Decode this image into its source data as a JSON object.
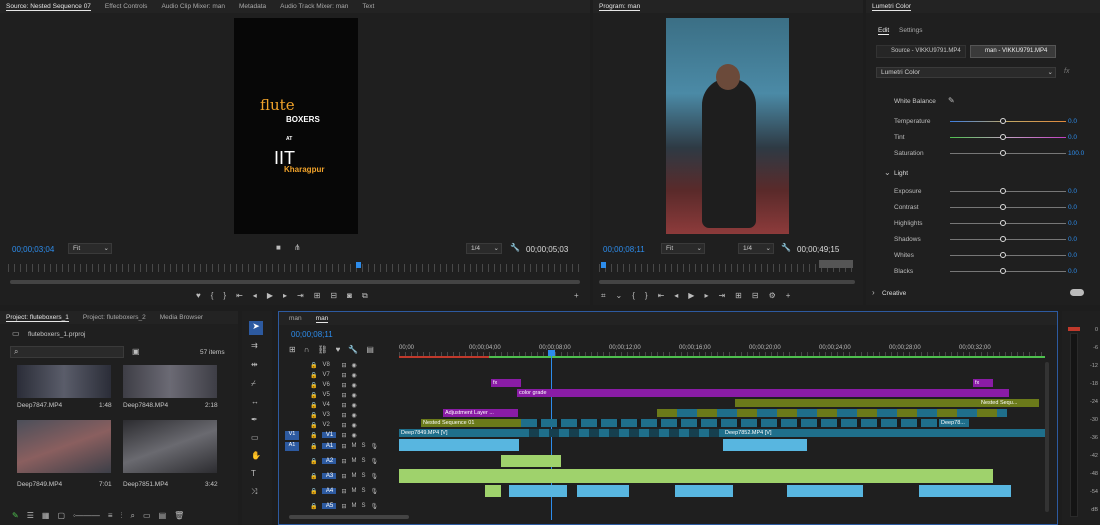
{
  "source_panel": {
    "tabs": [
      "Source: Nested Sequence 07",
      "Effect Controls",
      "Audio Clip Mixer: man",
      "Metadata",
      "Audio Track Mixer: man",
      "Text"
    ],
    "timecode_left": "00;00;03;04",
    "fit": "Fit",
    "resolution": "1/4",
    "timecode_right": "00;00;05;03",
    "preview": {
      "line1": "flute",
      "line2": "BOXERS",
      "line3": "AT",
      "line4": "IIT",
      "line5": "Kharagpur"
    }
  },
  "program_panel": {
    "tab": "Program: man",
    "timecode_left": "00;00;08;11",
    "fit": "Fit",
    "resolution": "1/4",
    "timecode_right": "00;00;49;15"
  },
  "lumetri": {
    "title": "Lumetri Color",
    "tabs": [
      "Edit",
      "Settings"
    ],
    "source_label": "Source - VIKKU9791.MP4",
    "clip_label": "man - VIKKU9791.MP4",
    "effect_dropdown": "Lumetri Color",
    "fx": "fx",
    "white_balance": "White Balance",
    "basic_rows": [
      {
        "label": "Temperature",
        "value": "0.0"
      },
      {
        "label": "Tint",
        "value": "0.0"
      },
      {
        "label": "Saturation",
        "value": "100.0"
      }
    ],
    "light_title": "Light",
    "light_rows": [
      {
        "label": "Exposure",
        "value": "0.0"
      },
      {
        "label": "Contrast",
        "value": "0.0"
      },
      {
        "label": "Highlights",
        "value": "0.0"
      },
      {
        "label": "Shadows",
        "value": "0.0"
      },
      {
        "label": "Whites",
        "value": "0.0"
      },
      {
        "label": "Blacks",
        "value": "0.0"
      }
    ],
    "creative": "Creative"
  },
  "project_panel": {
    "tabs": [
      "Project: fluteboxers_1",
      "Project: fluteboxers_2",
      "Media Browser"
    ],
    "project_file": "fluteboxers_1.prproj",
    "item_count": "57 items",
    "items": [
      {
        "name": "Deep7847.MP4",
        "duration": "1:48"
      },
      {
        "name": "Deep7848.MP4",
        "duration": "2:18"
      },
      {
        "name": "Deep7849.MP4",
        "duration": "7:01"
      },
      {
        "name": "Deep7851.MP4",
        "duration": "3:42"
      }
    ]
  },
  "timeline": {
    "tabs": [
      "man",
      "man"
    ],
    "timecode": "00;00;08;11",
    "ruler": [
      "00;00",
      "00;00;04;00",
      "00;00;08;00",
      "00;00;12;00",
      "00;00;16;00",
      "00;00;20;00",
      "00;00;24;00",
      "00;00;28;00",
      "00;00;32;00"
    ],
    "video_tracks": [
      "V8",
      "V7",
      "V6",
      "V5",
      "V4",
      "V3",
      "V2",
      "V1"
    ],
    "audio_tracks": [
      "A1",
      "A2",
      "A3",
      "A4",
      "A5"
    ],
    "track_targets": {
      "v": "V1",
      "a": "A1"
    },
    "ms": {
      "m": "M",
      "s": "S"
    },
    "clips": {
      "color_grade": "color grade",
      "adjustment": "Adjustment Layer ...",
      "nested01": "Nested Sequence 01",
      "deep7849": "Deep7849.MP4 [V]",
      "deep7852": "Deep7852.MP4 [V]",
      "deep78": "Deep78...",
      "nested_seq": "Nested Sequ...",
      "fx": "fx"
    }
  },
  "meter": {
    "ticks": [
      "0",
      "-6",
      "-12",
      "-18",
      "-24",
      "-30",
      "-36",
      "-42",
      "-48",
      "-54",
      "dB"
    ]
  }
}
